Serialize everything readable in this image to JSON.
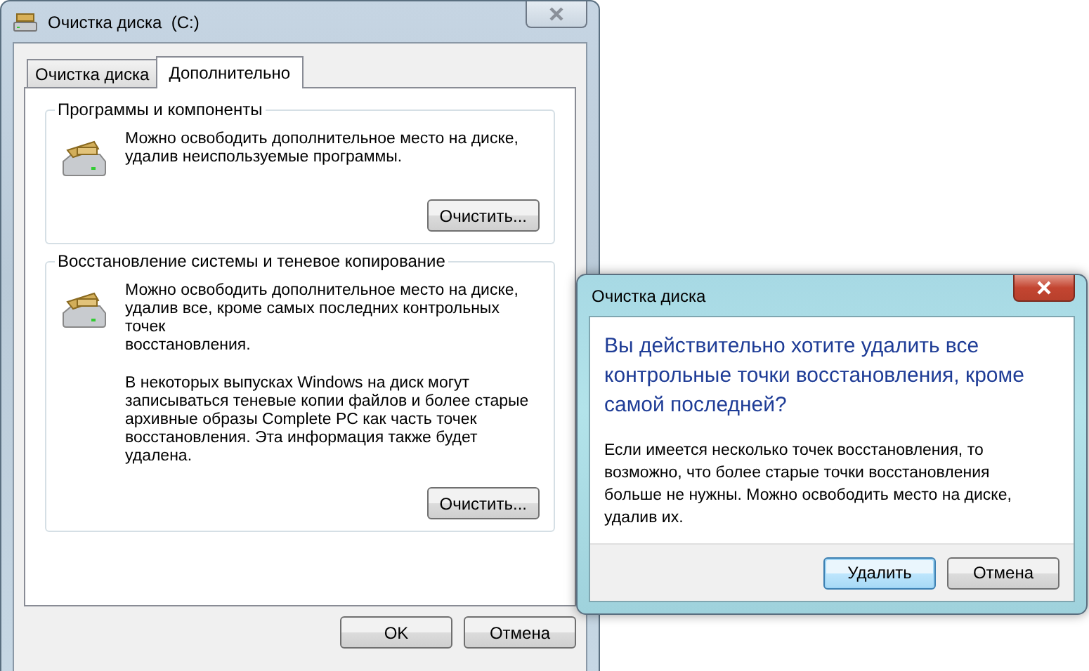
{
  "main_window": {
    "title": "Очистка диска  (C:)",
    "tabs": [
      {
        "label": "Очистка диска",
        "selected": false
      },
      {
        "label": "Дополнительно",
        "selected": true
      }
    ],
    "groups": [
      {
        "title": "Программы и компоненты",
        "paragraphs": [
          [
            "Можно освободить дополнительное место на диске,",
            "удалив неиспользуемые программы."
          ]
        ],
        "button": "Очистить..."
      },
      {
        "title": "Восстановление системы и теневое копирование",
        "paragraphs": [
          [
            "Можно освободить дополнительное место на диске,",
            "удалив все, кроме самых последних контрольных точек",
            "восстановления."
          ],
          [
            "В некоторых выпусках Windows на диск могут",
            "записываться теневые копии файлов и более старые",
            "архивные образы Complete PC как часть точек",
            "восстановления. Эта информация также будет удалена."
          ]
        ],
        "button": "Очистить..."
      }
    ],
    "buttons": [
      "OK",
      "Отмена"
    ]
  },
  "dialog": {
    "title": "Очистка диска",
    "heading": [
      "Вы действительно хотите удалить все",
      "контрольные точки восстановления, кроме",
      "самой последней?"
    ],
    "body": [
      "Если имеется несколько точек восстановления, то",
      "возможно, что более старые точки восстановления",
      "больше не нужны. Можно освободить место на диске,",
      "удалив их."
    ],
    "buttons": [
      {
        "label": "Удалить",
        "focused": true
      },
      {
        "label": "Отмена",
        "focused": false
      }
    ]
  }
}
